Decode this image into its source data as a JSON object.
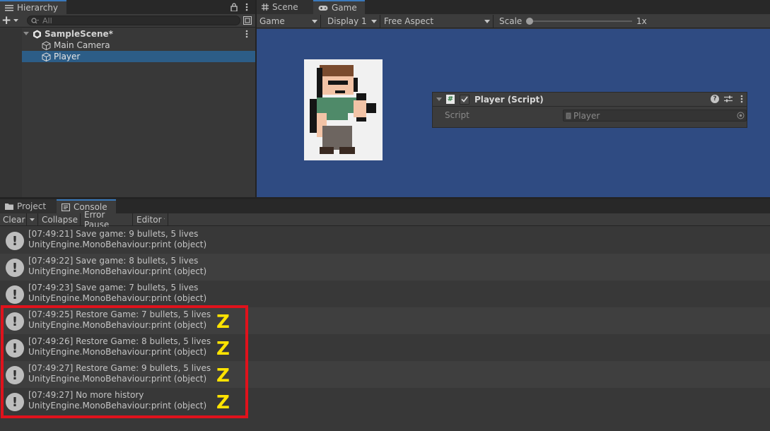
{
  "hierarchy": {
    "tab_label": "Hierarchy",
    "add_label": "+",
    "search_placeholder": "All",
    "scene_name": "SampleScene*",
    "items": [
      {
        "label": "Main Camera",
        "selected": false
      },
      {
        "label": "Player",
        "selected": true
      }
    ]
  },
  "view": {
    "tabs": [
      {
        "label": "Scene",
        "icon": "hash-grid-icon"
      },
      {
        "label": "Game",
        "icon": "gamepad-icon"
      }
    ],
    "toolbar": {
      "mode": "Game",
      "display": "Display 1",
      "aspect": "Free Aspect",
      "scale_label": "Scale",
      "scale_value": "1x",
      "scale_fraction": 0.0
    },
    "background_color": "#2f4b82"
  },
  "inspector": {
    "component_title": "Player (Script)",
    "enabled": true,
    "script_label": "Script",
    "script_value": "Player"
  },
  "bottom": {
    "tabs": [
      {
        "label": "Project",
        "icon": "folder-icon"
      },
      {
        "label": "Console",
        "icon": "console-icon"
      }
    ],
    "console_toolbar": {
      "clear": "Clear",
      "collapse": "Collapse",
      "error_pause": "Error Pause",
      "editor": "Editor"
    },
    "logs": [
      {
        "line1": "[07:49:21] Save game: 9 bullets, 5 lives",
        "line2": "UnityEngine.MonoBehaviour:print (object)",
        "mark": ""
      },
      {
        "line1": "[07:49:22] Save game: 8 bullets, 5 lives",
        "line2": "UnityEngine.MonoBehaviour:print (object)",
        "mark": ""
      },
      {
        "line1": "[07:49:23] Save game: 7 bullets, 5 lives",
        "line2": "UnityEngine.MonoBehaviour:print (object)",
        "mark": ""
      },
      {
        "line1": "[07:49:25] Restore Game: 7 bullets, 5 lives",
        "line2": "UnityEngine.MonoBehaviour:print (object)",
        "mark": "Z"
      },
      {
        "line1": "[07:49:26] Restore Game: 8 bullets, 5 lives",
        "line2": "UnityEngine.MonoBehaviour:print (object)",
        "mark": "Z"
      },
      {
        "line1": "[07:49:27] Restore Game: 9 bullets, 5 lives",
        "line2": "UnityEngine.MonoBehaviour:print (object)",
        "mark": "Z"
      },
      {
        "line1": "[07:49:27] No more history",
        "line2": "UnityEngine.MonoBehaviour:print (object)",
        "mark": "Z"
      }
    ],
    "highlight_color": "#e0121c",
    "mark_color": "#ffe300"
  }
}
